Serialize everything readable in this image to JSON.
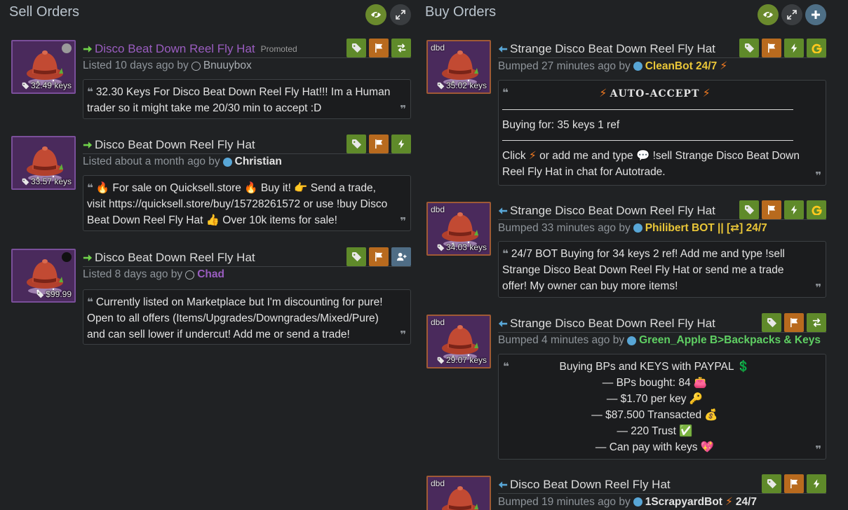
{
  "sell": {
    "title": "Sell Orders",
    "listings": [
      {
        "price": "32.49 keys",
        "title": "Disco Beat Down Reel Fly Hat",
        "promoted": "Promoted",
        "listed": "Listed 10 days ago by",
        "user": "Bnuuybox",
        "comment": "32.30 Keys For Disco Beat Down Reel Fly Hat!!! Im a Human trader so it might take me 20/30 min to accept :D"
      },
      {
        "price": "33.57 keys",
        "title": "Disco Beat Down Reel Fly Hat",
        "listed": "Listed about a month ago by",
        "user": "Christian",
        "comment": "🔥 For sale on Quicksell.store 🔥  Buy it!  👉  Send a trade, visit https://quicksell.store/buy/15728261572 or use !buy Disco Beat Down Reel Fly Hat  👍  Over 10k items for sale!"
      },
      {
        "price": "$99.99",
        "title": "Disco Beat Down Reel Fly Hat",
        "listed": "Listed 8 days ago by",
        "user": "Chad",
        "comment": "Currently listed on Marketplace but I'm discounting for pure! Open to all offers (Items/Upgrades/Downgrades/Mixed/Pure) and can sell lower if undercut! Add me or send a trade!"
      }
    ]
  },
  "buy": {
    "title": "Buy Orders",
    "listings": [
      {
        "tag": "dbd",
        "price": "35.02 keys",
        "title": "Strange Disco Beat Down Reel Fly Hat",
        "listed": "Bumped 27 minutes ago by",
        "user": "CleanBot 24/7",
        "auto_accept": "AUTO-ACCEPT",
        "buying_for": "Buying for: 35 keys 1 ref",
        "click_text": "Click",
        "or_add": "or add me and type",
        "sell_cmd": "!sell Strange Disco Beat Down Reel Fly Hat in chat for Autotrade."
      },
      {
        "tag": "dbd",
        "price": "34.03 keys",
        "title": "Strange Disco Beat Down Reel Fly Hat",
        "listed": "Bumped 33 minutes ago by",
        "user": "Philibert BOT || [⇄] 24/7",
        "comment": "24/7 BOT Buying for 34 keys 2 ref! Add me and type !sell Strange Disco Beat Down Reel Fly Hat or send me a trade offer! My owner can buy more items!"
      },
      {
        "tag": "dbd",
        "price": "29.07 keys",
        "title": "Strange Disco Beat Down Reel Fly Hat",
        "listed": "Bumped 4 minutes ago by",
        "user": "Green_Apple B>Backpacks & Keys",
        "lines": [
          "Buying BPs and KEYS with PAYPAL 💲",
          "— BPs bought: 84 👛",
          "— $1.70 per key 🔑",
          "— $87.500 Transacted 💰",
          "— 220 Trust ✅",
          "— Can pay with keys 💖"
        ]
      },
      {
        "tag": "dbd",
        "title": "Disco Beat Down Reel Fly Hat",
        "listed": "Bumped 19 minutes ago by",
        "user": "1ScrapyardBot",
        "user_suffix": "24/7"
      }
    ]
  },
  "colors": {
    "accent_green": "#5f8a2a",
    "accent_orange": "#b86a1e",
    "unusual_purple": "#9a5dc0"
  }
}
